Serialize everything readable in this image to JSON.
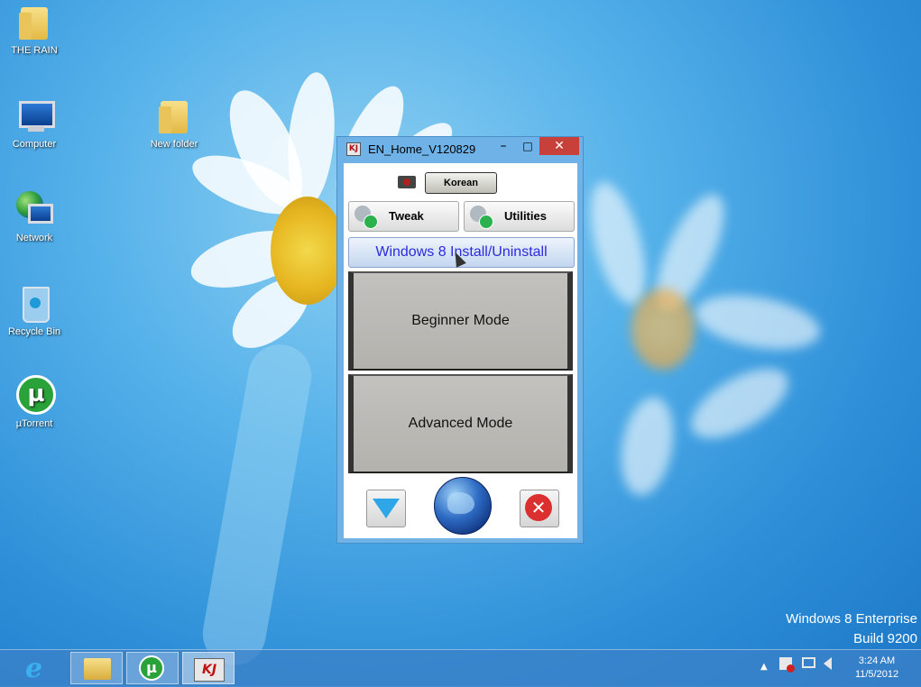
{
  "desktop": {
    "icons": [
      {
        "label": "THE RAIN"
      },
      {
        "label": "Computer"
      },
      {
        "label": "New folder"
      },
      {
        "label": "Network"
      },
      {
        "label": "Recycle Bin"
      },
      {
        "label": "µTorrent"
      }
    ],
    "watermark": {
      "line1": "Windows 8 Enterprise",
      "line2": "Build 9200"
    }
  },
  "window": {
    "title": "EN_Home_V120829",
    "minimize_symbol": "–",
    "maximize_symbol": "□",
    "close_symbol": "✕",
    "language_button": "Korean",
    "tweak_button": "Tweak",
    "utilities_button": "Utilities",
    "install_button": "Windows 8 Install/Uninstall",
    "beginner_button": "Beginner Mode",
    "advanced_button": "Advanced Mode",
    "close_app_symbol": "✕"
  },
  "taskbar": {
    "ie_glyph": "e",
    "utorrent_glyph": "µ",
    "kj_glyph": "KJ",
    "tray_arrow": "▲",
    "clock_time": "3:24 AM",
    "clock_date": "11/5/2012"
  }
}
